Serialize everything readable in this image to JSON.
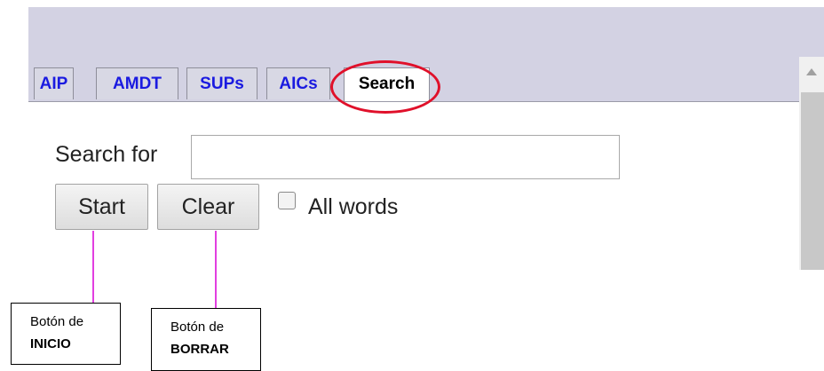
{
  "tabs": [
    {
      "label": "AIP",
      "active": false
    },
    {
      "label": "AMDT",
      "active": false
    },
    {
      "label": "SUPs",
      "active": false
    },
    {
      "label": "AICs",
      "active": false
    },
    {
      "label": "Search",
      "active": true
    }
  ],
  "search": {
    "label": "Search for",
    "value": "",
    "placeholder": ""
  },
  "buttons": {
    "start": "Start",
    "clear": "Clear"
  },
  "options": {
    "all_words_label": "All words",
    "all_words_checked": false
  },
  "annotations": {
    "start": {
      "line1": "Botón de",
      "line2": "INICIO"
    },
    "clear": {
      "line1": "Botón de",
      "line2": "BORRAR"
    },
    "highlight_color": "#e0102a",
    "connector_color": "#e23fe0"
  },
  "colors": {
    "header_bg": "#d3d2e3",
    "tab_text": "#1a1ae0"
  }
}
